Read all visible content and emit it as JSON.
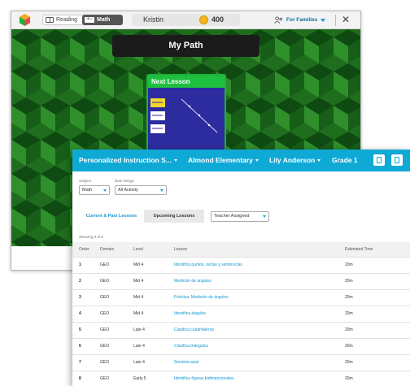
{
  "student_app": {
    "tabs": {
      "reading": "Reading",
      "math": "Math"
    },
    "student_name": "Kristin",
    "coins": "400",
    "families_menu": "For Families",
    "page_title": "My Path",
    "next_lesson": {
      "header": "Next Lesson"
    }
  },
  "teacher_app": {
    "header": {
      "program": "Personalized Instruction S...",
      "school": "Almond Elementary",
      "student": "Lily Anderson",
      "grade": "Grade 1"
    },
    "filters": {
      "subject_label": "Subject",
      "subject_value": "Math",
      "date_range_label": "Date Range",
      "date_range_value": "All Activity"
    },
    "tabs": {
      "current_past": "Current & Past Lessons",
      "upcoming": "Upcoming Lessons",
      "teacher_assigned": "Teacher Assigned"
    },
    "showing": "Showing 8 of 8",
    "table": {
      "headers": [
        "Order",
        "Domain",
        "Level",
        "Lesson",
        "Estimated Time"
      ],
      "rows": [
        [
          "1",
          "GEO",
          "Mid 4",
          "Identifica puntos, rectas y semirrectas",
          "20m"
        ],
        [
          "2",
          "GEO",
          "Mid 4",
          "Medición de ángulos",
          "20m"
        ],
        [
          "3",
          "GEO",
          "Mid 4",
          "Práctica: Medición de ángulos",
          "20m"
        ],
        [
          "4",
          "GEO",
          "Mid 4",
          "Identifica ángulos",
          "20m"
        ],
        [
          "5",
          "GEO",
          "Late 4",
          "Clasifica cuadriláteros",
          "20m"
        ],
        [
          "6",
          "GEO",
          "Late 4",
          "Clasifica triángulos",
          "20m"
        ],
        [
          "7",
          "GEO",
          "Late 4",
          "Simetría axial",
          "20m"
        ],
        [
          "8",
          "GEO",
          "Early 5",
          "Identifica figuras bidimensionales",
          "20m"
        ]
      ]
    }
  },
  "colors": {
    "header_blue": "#0fa9d6",
    "link_blue": "#1496d2",
    "green_bg": "#1e6b1c",
    "lesson_green": "#1fbf3f",
    "coin_gold": "#f4b81c"
  }
}
